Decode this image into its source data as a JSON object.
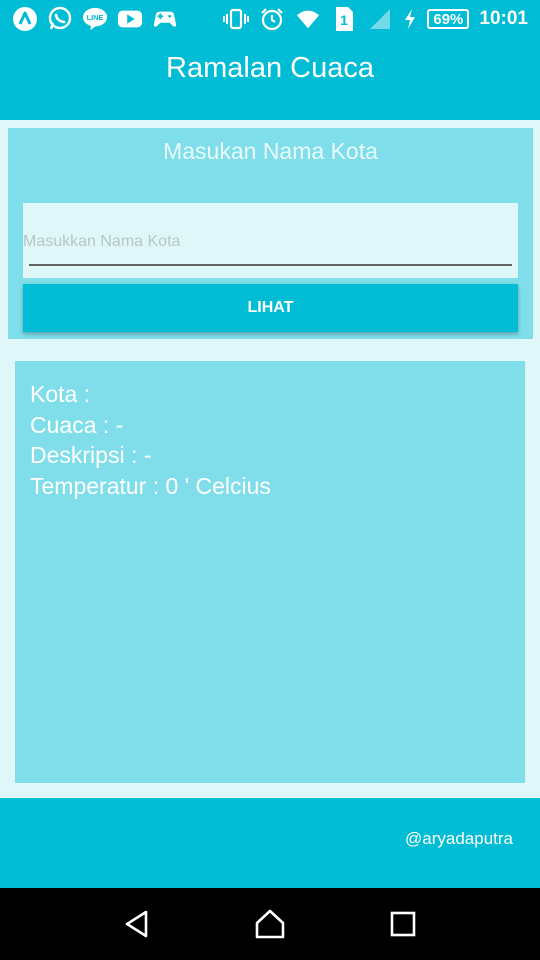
{
  "status_bar": {
    "left_icons": [
      "app-a-icon",
      "whatsapp-icon",
      "line-icon",
      "youtube-icon",
      "game-controller-icon"
    ],
    "right_icons": [
      "vibrate-icon",
      "alarm-icon",
      "wifi-icon",
      "sim-icon",
      "signal-icon",
      "charging-icon"
    ],
    "sim_slot": "1",
    "battery": "69%",
    "time": "10:01"
  },
  "app_bar": {
    "title": "Ramalan Cuaca"
  },
  "input_section": {
    "heading": "Masukan Nama Kota",
    "city_input": {
      "value": "",
      "placeholder": "Masukkan Nama Kota"
    },
    "button_label": "LIHAT"
  },
  "result": {
    "kota": "Kota :",
    "cuaca": "Cuaca : -",
    "deskripsi": "Deskripsi : -",
    "temperatur": "Temperatur : 0 ' Celcius"
  },
  "footer": {
    "credit": "@aryadaputra"
  },
  "nav_bar": {
    "buttons": [
      "back-icon",
      "home-icon",
      "recents-icon"
    ]
  },
  "colors": {
    "primary": "#00bcd4",
    "panel": "#80deea",
    "background": "#e0f7fa",
    "nav": "#000000"
  }
}
